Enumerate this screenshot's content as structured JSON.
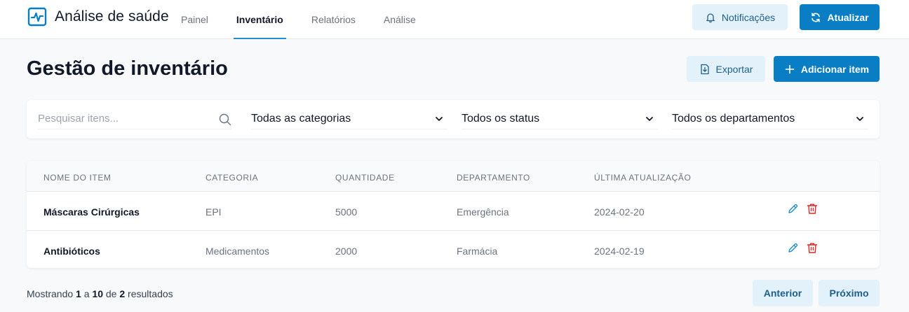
{
  "app": {
    "title": "Análise de saúde",
    "logo_icon": "heart-pulse-icon"
  },
  "nav": {
    "items": [
      {
        "label": "Painel",
        "active": false
      },
      {
        "label": "Inventário",
        "active": true
      },
      {
        "label": "Relatórios",
        "active": false
      },
      {
        "label": "Análise",
        "active": false
      }
    ]
  },
  "header_actions": {
    "notifications_label": "Notificações",
    "notifications_icon": "bell-icon",
    "refresh_label": "Atualizar",
    "refresh_icon": "refresh-icon"
  },
  "page": {
    "title": "Gestão de inventário",
    "export_label": "Exportar",
    "export_icon": "file-download-icon",
    "add_label": "Adicionar item",
    "add_icon": "plus-icon"
  },
  "filters": {
    "search_placeholder": "Pesquisar itens...",
    "search_value": "",
    "category_selected": "Todas as categorias",
    "status_selected": "Todos os status",
    "department_selected": "Todos os departamentos"
  },
  "table": {
    "columns": [
      "Nome do item",
      "Categoria",
      "Quantidade",
      "Departamento",
      "Última atualização"
    ],
    "rows": [
      {
        "name": "Máscaras Cirúrgicas",
        "category": "EPI",
        "quantity": "5000",
        "department": "Emergência",
        "updated": "2024-02-20"
      },
      {
        "name": "Antibióticos",
        "category": "Medicamentos",
        "quantity": "2000",
        "department": "Farmácia",
        "updated": "2024-02-19"
      }
    ]
  },
  "pagination": {
    "prefix": "Mostrando",
    "from": "1",
    "sep": "a",
    "to": "10",
    "of": "de",
    "total": "2",
    "suffix": "resultados",
    "prev_label": "Anterior",
    "next_label": "Próximo"
  },
  "colors": {
    "primary": "#0a7ec4",
    "light_button": "#e3f1fb",
    "active_tab": "#1f8fce",
    "edit_icon": "#1f8fce",
    "delete_icon": "#dc2626"
  }
}
